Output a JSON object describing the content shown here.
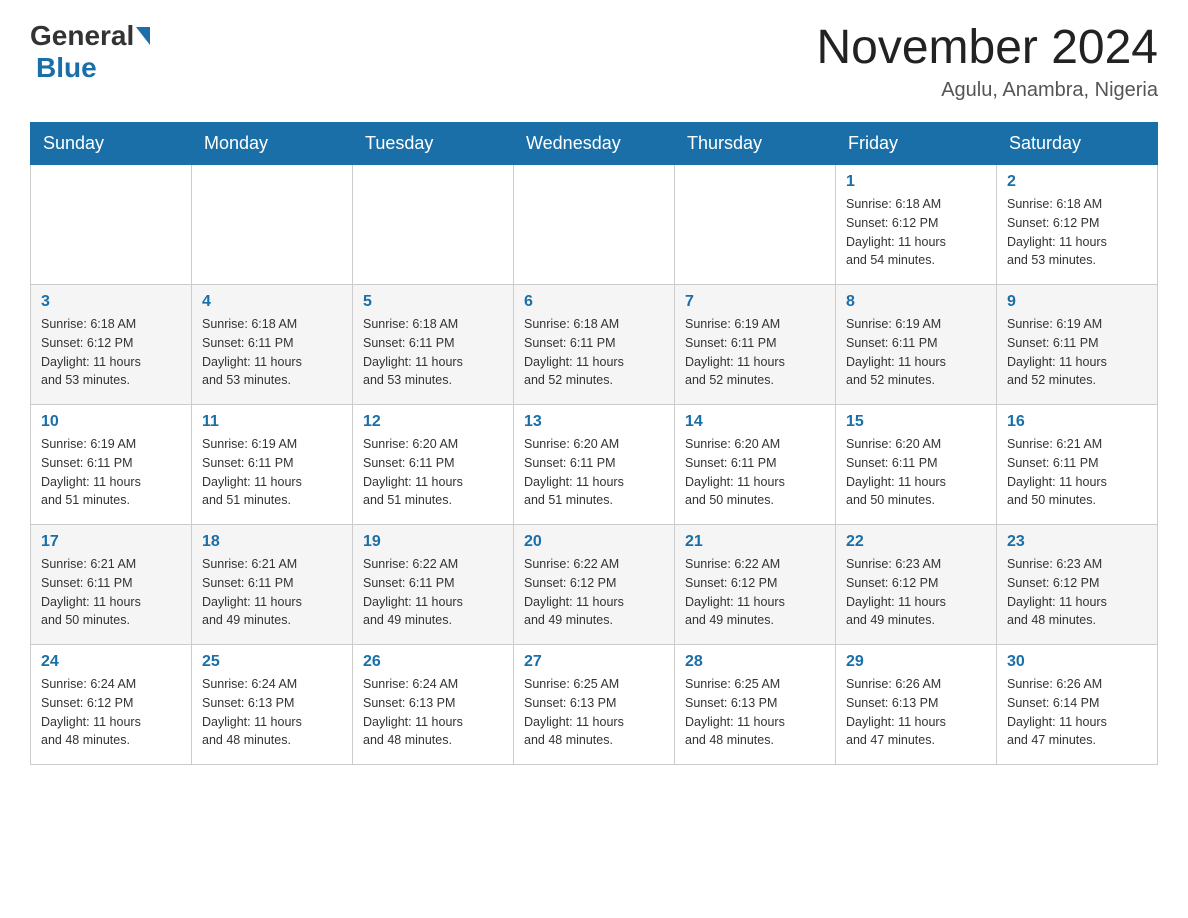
{
  "header": {
    "logo_general": "General",
    "logo_blue": "Blue",
    "month_title": "November 2024",
    "location": "Agulu, Anambra, Nigeria"
  },
  "days_of_week": [
    "Sunday",
    "Monday",
    "Tuesday",
    "Wednesday",
    "Thursday",
    "Friday",
    "Saturday"
  ],
  "weeks": [
    [
      {
        "day": "",
        "info": ""
      },
      {
        "day": "",
        "info": ""
      },
      {
        "day": "",
        "info": ""
      },
      {
        "day": "",
        "info": ""
      },
      {
        "day": "",
        "info": ""
      },
      {
        "day": "1",
        "info": "Sunrise: 6:18 AM\nSunset: 6:12 PM\nDaylight: 11 hours\nand 54 minutes."
      },
      {
        "day": "2",
        "info": "Sunrise: 6:18 AM\nSunset: 6:12 PM\nDaylight: 11 hours\nand 53 minutes."
      }
    ],
    [
      {
        "day": "3",
        "info": "Sunrise: 6:18 AM\nSunset: 6:12 PM\nDaylight: 11 hours\nand 53 minutes."
      },
      {
        "day": "4",
        "info": "Sunrise: 6:18 AM\nSunset: 6:11 PM\nDaylight: 11 hours\nand 53 minutes."
      },
      {
        "day": "5",
        "info": "Sunrise: 6:18 AM\nSunset: 6:11 PM\nDaylight: 11 hours\nand 53 minutes."
      },
      {
        "day": "6",
        "info": "Sunrise: 6:18 AM\nSunset: 6:11 PM\nDaylight: 11 hours\nand 52 minutes."
      },
      {
        "day": "7",
        "info": "Sunrise: 6:19 AM\nSunset: 6:11 PM\nDaylight: 11 hours\nand 52 minutes."
      },
      {
        "day": "8",
        "info": "Sunrise: 6:19 AM\nSunset: 6:11 PM\nDaylight: 11 hours\nand 52 minutes."
      },
      {
        "day": "9",
        "info": "Sunrise: 6:19 AM\nSunset: 6:11 PM\nDaylight: 11 hours\nand 52 minutes."
      }
    ],
    [
      {
        "day": "10",
        "info": "Sunrise: 6:19 AM\nSunset: 6:11 PM\nDaylight: 11 hours\nand 51 minutes."
      },
      {
        "day": "11",
        "info": "Sunrise: 6:19 AM\nSunset: 6:11 PM\nDaylight: 11 hours\nand 51 minutes."
      },
      {
        "day": "12",
        "info": "Sunrise: 6:20 AM\nSunset: 6:11 PM\nDaylight: 11 hours\nand 51 minutes."
      },
      {
        "day": "13",
        "info": "Sunrise: 6:20 AM\nSunset: 6:11 PM\nDaylight: 11 hours\nand 51 minutes."
      },
      {
        "day": "14",
        "info": "Sunrise: 6:20 AM\nSunset: 6:11 PM\nDaylight: 11 hours\nand 50 minutes."
      },
      {
        "day": "15",
        "info": "Sunrise: 6:20 AM\nSunset: 6:11 PM\nDaylight: 11 hours\nand 50 minutes."
      },
      {
        "day": "16",
        "info": "Sunrise: 6:21 AM\nSunset: 6:11 PM\nDaylight: 11 hours\nand 50 minutes."
      }
    ],
    [
      {
        "day": "17",
        "info": "Sunrise: 6:21 AM\nSunset: 6:11 PM\nDaylight: 11 hours\nand 50 minutes."
      },
      {
        "day": "18",
        "info": "Sunrise: 6:21 AM\nSunset: 6:11 PM\nDaylight: 11 hours\nand 49 minutes."
      },
      {
        "day": "19",
        "info": "Sunrise: 6:22 AM\nSunset: 6:11 PM\nDaylight: 11 hours\nand 49 minutes."
      },
      {
        "day": "20",
        "info": "Sunrise: 6:22 AM\nSunset: 6:12 PM\nDaylight: 11 hours\nand 49 minutes."
      },
      {
        "day": "21",
        "info": "Sunrise: 6:22 AM\nSunset: 6:12 PM\nDaylight: 11 hours\nand 49 minutes."
      },
      {
        "day": "22",
        "info": "Sunrise: 6:23 AM\nSunset: 6:12 PM\nDaylight: 11 hours\nand 49 minutes."
      },
      {
        "day": "23",
        "info": "Sunrise: 6:23 AM\nSunset: 6:12 PM\nDaylight: 11 hours\nand 48 minutes."
      }
    ],
    [
      {
        "day": "24",
        "info": "Sunrise: 6:24 AM\nSunset: 6:12 PM\nDaylight: 11 hours\nand 48 minutes."
      },
      {
        "day": "25",
        "info": "Sunrise: 6:24 AM\nSunset: 6:13 PM\nDaylight: 11 hours\nand 48 minutes."
      },
      {
        "day": "26",
        "info": "Sunrise: 6:24 AM\nSunset: 6:13 PM\nDaylight: 11 hours\nand 48 minutes."
      },
      {
        "day": "27",
        "info": "Sunrise: 6:25 AM\nSunset: 6:13 PM\nDaylight: 11 hours\nand 48 minutes."
      },
      {
        "day": "28",
        "info": "Sunrise: 6:25 AM\nSunset: 6:13 PM\nDaylight: 11 hours\nand 48 minutes."
      },
      {
        "day": "29",
        "info": "Sunrise: 6:26 AM\nSunset: 6:13 PM\nDaylight: 11 hours\nand 47 minutes."
      },
      {
        "day": "30",
        "info": "Sunrise: 6:26 AM\nSunset: 6:14 PM\nDaylight: 11 hours\nand 47 minutes."
      }
    ]
  ]
}
